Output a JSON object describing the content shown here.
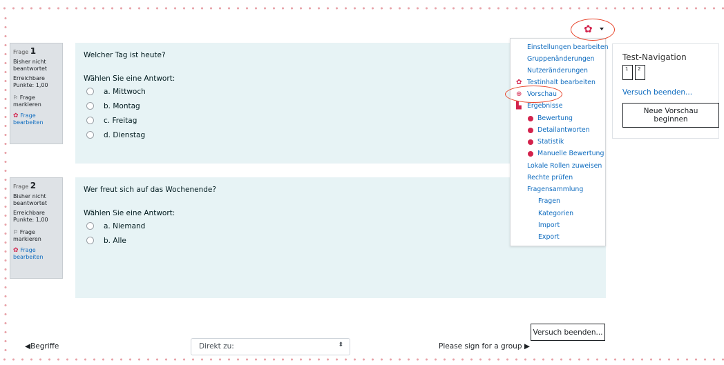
{
  "questions": [
    {
      "label": "Frage",
      "number": "1",
      "status": "Bisher nicht beantwortet",
      "points": "Erreichbare Punkte: 1,00",
      "flag": "Frage markieren",
      "edit": "Frage bearbeiten",
      "text": "Welcher Tag ist heute?",
      "prompt": "Wählen Sie eine Antwort:",
      "answers": [
        "a. Mittwoch",
        "b. Montag",
        "c. Freitag",
        "d. Dienstag"
      ]
    },
    {
      "label": "Frage",
      "number": "2",
      "status": "Bisher nicht beantwortet",
      "points": "Erreichbare Punkte: 1,00",
      "flag": "Frage markieren",
      "edit": "Frage bearbeiten",
      "text": "Wer freut sich auf das Wochenende?",
      "prompt": "Wählen Sie eine Antwort:",
      "answers": [
        "a. Niemand",
        "b. Alle"
      ]
    }
  ],
  "menu": {
    "items": [
      "Einstellungen bearbeiten",
      "Gruppenänderungen",
      "Nutzeränderungen",
      "Testinhalt bearbeiten",
      "Vorschau",
      "Ergebnisse",
      "Bewertung",
      "Detailantworten",
      "Statistik",
      "Manuelle Bewertung",
      "Lokale Rollen zuweisen",
      "Rechte prüfen",
      "Fragensammlung",
      "Fragen",
      "Kategorien",
      "Import",
      "Export"
    ]
  },
  "navigation": {
    "title": "Test-Navigation",
    "buttons": [
      "1",
      "2"
    ],
    "finish_link": "Versuch beenden...",
    "new_preview": "Neue Vorschau beginnen"
  },
  "footer": {
    "finish_button": "Versuch beenden...",
    "prev_link": "◀Begriffe",
    "jump_select": "Direkt zu:",
    "next_link": "Please sign for a group ▶"
  },
  "colors": {
    "accent": "#d3224c",
    "link": "#0f6cbf",
    "question_bg": "#e7f3f5",
    "highlight": "#e8442a"
  }
}
